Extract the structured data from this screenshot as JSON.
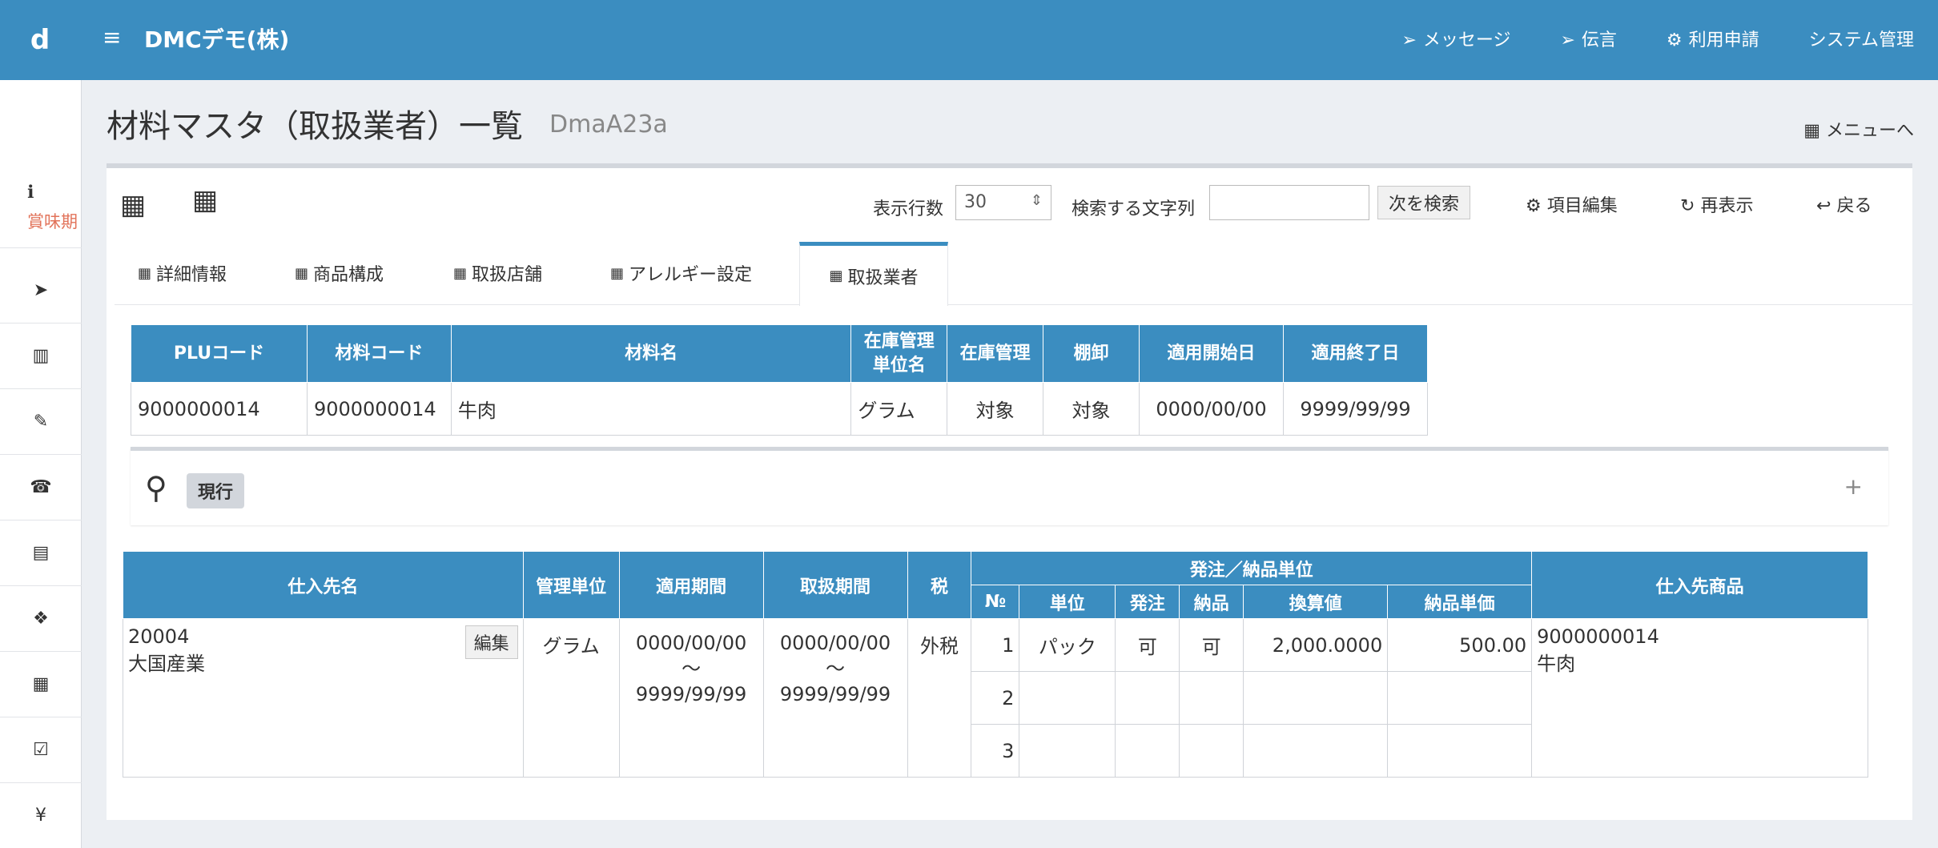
{
  "header": {
    "logo": "d",
    "app_title": "DMCデモ(株)",
    "nav": [
      {
        "icon": "paper-plane-icon",
        "label": "メッセージ"
      },
      {
        "icon": "paper-plane-icon",
        "label": "伝言"
      },
      {
        "icon": "gear-icon",
        "label": "利用申請"
      },
      {
        "icon": "",
        "label": "システム管理"
      }
    ]
  },
  "sidebar": {
    "first_label": "賞味期",
    "icons": [
      "info-icon",
      "paper-plane-icon",
      "bar-chart-icon",
      "edit-icon",
      "fax-icon",
      "file-icon",
      "cubes-icon",
      "calendar-icon",
      "calendar-check-icon",
      "yen-icon"
    ]
  },
  "page": {
    "title": "材料マスタ（取扱業者）一覧",
    "code": "DmaA23a",
    "menu_link": "メニューへ"
  },
  "toolbar": {
    "rows_label": "表示行数",
    "rows_value": "30",
    "search_label": "検索する文字列",
    "search_value": "",
    "search_next": "次を検索",
    "edit_items": "項目編集",
    "refresh": "再表示",
    "back": "戻る"
  },
  "tabs": [
    {
      "label": "詳細情報",
      "active": false
    },
    {
      "label": "商品構成",
      "active": false
    },
    {
      "label": "取扱店舗",
      "active": false
    },
    {
      "label": "アレルギー設定",
      "active": false
    },
    {
      "label": "取扱業者",
      "active": true
    }
  ],
  "material": {
    "headers": [
      "PLUコード",
      "材料コード",
      "材料名",
      "在庫管理単位名",
      "在庫管理",
      "棚卸",
      "適用開始日",
      "適用終了日"
    ],
    "header_unit_line1": "在庫管理",
    "header_unit_line2": "単位名",
    "row": {
      "plu": "9000000014",
      "code": "9000000014",
      "name": "牛肉",
      "unit": "グラム",
      "stock": "対象",
      "inventory": "対象",
      "start": "0000/00/00",
      "end": "9999/99/99"
    }
  },
  "filter": {
    "badge": "現行",
    "expand": "+"
  },
  "suppliers": {
    "headers": {
      "name": "仕入先名",
      "unit": "管理単位",
      "period": "適用期間",
      "handling": "取扱期間",
      "tax": "税",
      "order_group": "発注／納品単位",
      "no": "№",
      "order_unit": "単位",
      "order": "発注",
      "delivery": "納品",
      "conversion": "換算値",
      "price": "納品単価",
      "product": "仕入先商品"
    },
    "row": {
      "code": "20004",
      "name": "大国産業",
      "edit": "編集",
      "unit": "グラム",
      "period_from": "0000/00/00",
      "period_to": "9999/99/99",
      "handling_from": "0000/00/00",
      "handling_to": "9999/99/99",
      "tilde": "～",
      "tax": "外税",
      "product_code": "9000000014",
      "product_name": "牛肉",
      "units": [
        {
          "no": "1",
          "unit": "パック",
          "order": "可",
          "delivery": "可",
          "conversion": "2,000.0000",
          "price": "500.00"
        },
        {
          "no": "2",
          "unit": "",
          "order": "",
          "delivery": "",
          "conversion": "",
          "price": ""
        },
        {
          "no": "3",
          "unit": "",
          "order": "",
          "delivery": "",
          "conversion": "",
          "price": ""
        }
      ]
    }
  },
  "colors": {
    "header_blue": "#3b8dc0",
    "accent_orange": "#e2735a"
  }
}
